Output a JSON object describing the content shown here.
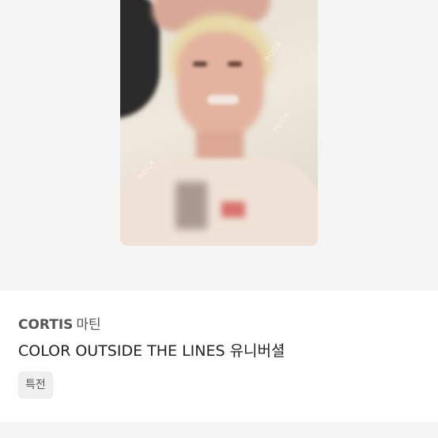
{
  "product": {
    "artist": "CORTIS",
    "member": "마틴",
    "album": "COLOR OUTSIDE THE LINES 유니버셜",
    "tag": "특전"
  },
  "image": {
    "watermark": "POCA"
  }
}
